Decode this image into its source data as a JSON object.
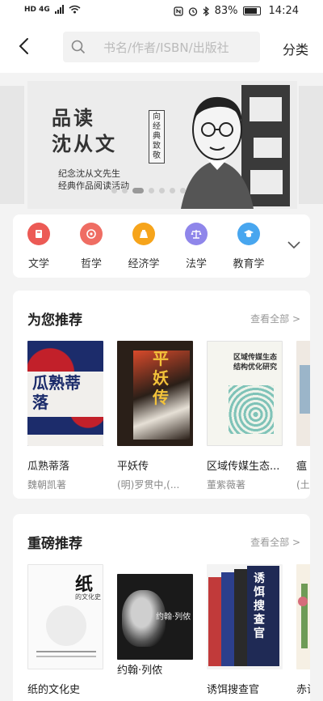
{
  "status": {
    "left": "HD 4G",
    "battery": "83%",
    "time": "14:24"
  },
  "header": {
    "back_icon": "back-arrow-icon",
    "search_placeholder": "书名/作者/ISBN/出版社",
    "category_label": "分类"
  },
  "banner": {
    "title_line1": "品读",
    "title_line2": "沈从文",
    "vertical_tag": "向经典致敬",
    "subtitle1": "纪念沈从文先生",
    "subtitle2": "经典作品阅读活动"
  },
  "categories": [
    {
      "label": "文学",
      "color": "#ec5a55",
      "icon": "book-icon"
    },
    {
      "label": "哲学",
      "color": "#ef6d63",
      "icon": "thinker-icon"
    },
    {
      "label": "经济学",
      "color": "#f6a41b",
      "icon": "money-bag-icon"
    },
    {
      "label": "法学",
      "color": "#8f86ea",
      "icon": "scales-icon"
    },
    {
      "label": "教育学",
      "color": "#48a6ef",
      "icon": "graduation-cap-icon"
    }
  ],
  "recommend": {
    "title": "为您推荐",
    "more": "查看全部 >",
    "books": [
      {
        "title": "瓜熟蒂落",
        "author": "魏朝凯著",
        "cover_text": "瓜熟蒂落"
      },
      {
        "title": "平妖传",
        "author": "(明)罗贯中,(...",
        "cover_text": "平妖传"
      },
      {
        "title": "区域传媒生态...",
        "author": "董紫薇著",
        "cover_text": "区域传媒生态结构优化研究"
      },
      {
        "title": "瘟",
        "author": "(土",
        "cover_text": ""
      }
    ]
  },
  "featured": {
    "title": "重磅推荐",
    "more": "查看全部 >",
    "books": [
      {
        "title": "纸的文化史",
        "author": "",
        "cover_text": "纸",
        "cover_sub": "的文化史"
      },
      {
        "title": "约翰·列侬",
        "author": "",
        "cover_text": "约翰·列侬"
      },
      {
        "title": "诱饵搜查官",
        "author": "",
        "cover_text": "诱饵搜查官"
      },
      {
        "title": "赤试",
        "author": "",
        "cover_text": ""
      }
    ]
  }
}
